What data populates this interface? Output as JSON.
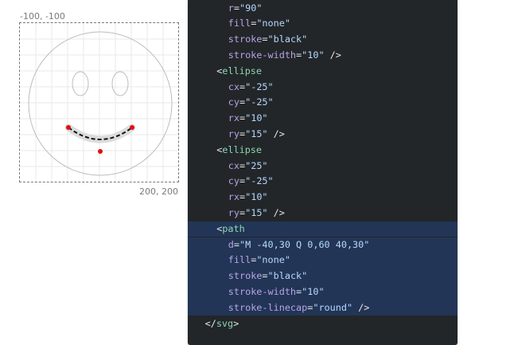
{
  "preview": {
    "coord_top_left": "-100, -100",
    "coord_bottom_right": "200, 200"
  },
  "code": {
    "lines": [
      {
        "indent": 3,
        "parts": [
          {
            "t": "attr",
            "v": "r"
          },
          {
            "t": "punc",
            "v": "="
          },
          {
            "t": "str",
            "v": "\"90\""
          }
        ]
      },
      {
        "indent": 3,
        "parts": [
          {
            "t": "attr",
            "v": "fill"
          },
          {
            "t": "punc",
            "v": "="
          },
          {
            "t": "str",
            "v": "\"none\""
          }
        ]
      },
      {
        "indent": 3,
        "parts": [
          {
            "t": "attr",
            "v": "stroke"
          },
          {
            "t": "punc",
            "v": "="
          },
          {
            "t": "str",
            "v": "\"black\""
          }
        ]
      },
      {
        "indent": 3,
        "parts": [
          {
            "t": "attr",
            "v": "stroke-width"
          },
          {
            "t": "punc",
            "v": "="
          },
          {
            "t": "str",
            "v": "\"10\""
          },
          {
            "t": "punc",
            "v": " />"
          }
        ]
      },
      {
        "indent": 2,
        "parts": [
          {
            "t": "punc",
            "v": "<"
          },
          {
            "t": "tag",
            "v": "ellipse"
          }
        ]
      },
      {
        "indent": 3,
        "parts": [
          {
            "t": "attr",
            "v": "cx"
          },
          {
            "t": "punc",
            "v": "="
          },
          {
            "t": "str",
            "v": "\"-25\""
          }
        ]
      },
      {
        "indent": 3,
        "parts": [
          {
            "t": "attr",
            "v": "cy"
          },
          {
            "t": "punc",
            "v": "="
          },
          {
            "t": "str",
            "v": "\"-25\""
          }
        ]
      },
      {
        "indent": 3,
        "parts": [
          {
            "t": "attr",
            "v": "rx"
          },
          {
            "t": "punc",
            "v": "="
          },
          {
            "t": "str",
            "v": "\"10\""
          }
        ]
      },
      {
        "indent": 3,
        "parts": [
          {
            "t": "attr",
            "v": "ry"
          },
          {
            "t": "punc",
            "v": "="
          },
          {
            "t": "str",
            "v": "\"15\""
          },
          {
            "t": "punc",
            "v": " />"
          }
        ]
      },
      {
        "indent": 2,
        "parts": [
          {
            "t": "punc",
            "v": "<"
          },
          {
            "t": "tag",
            "v": "ellipse"
          }
        ]
      },
      {
        "indent": 3,
        "parts": [
          {
            "t": "attr",
            "v": "cx"
          },
          {
            "t": "punc",
            "v": "="
          },
          {
            "t": "str",
            "v": "\"25\""
          }
        ]
      },
      {
        "indent": 3,
        "parts": [
          {
            "t": "attr",
            "v": "cy"
          },
          {
            "t": "punc",
            "v": "="
          },
          {
            "t": "str",
            "v": "\"-25\""
          }
        ]
      },
      {
        "indent": 3,
        "parts": [
          {
            "t": "attr",
            "v": "rx"
          },
          {
            "t": "punc",
            "v": "="
          },
          {
            "t": "str",
            "v": "\"10\""
          }
        ]
      },
      {
        "indent": 3,
        "parts": [
          {
            "t": "attr",
            "v": "ry"
          },
          {
            "t": "punc",
            "v": "="
          },
          {
            "t": "str",
            "v": "\"15\""
          },
          {
            "t": "punc",
            "v": " />"
          }
        ]
      },
      {
        "indent": 2,
        "highlight": true,
        "parts": [
          {
            "t": "punc",
            "v": "<"
          },
          {
            "t": "tag",
            "v": "path"
          }
        ]
      },
      {
        "indent": 3,
        "highlight": true,
        "parts": [
          {
            "t": "attr",
            "v": "d"
          },
          {
            "t": "punc",
            "v": "="
          },
          {
            "t": "str",
            "v": "\"M -40,30 Q 0,60 40,30\""
          }
        ]
      },
      {
        "indent": 3,
        "highlight": true,
        "parts": [
          {
            "t": "attr",
            "v": "fill"
          },
          {
            "t": "punc",
            "v": "="
          },
          {
            "t": "str",
            "v": "\"none\""
          }
        ]
      },
      {
        "indent": 3,
        "highlight": true,
        "parts": [
          {
            "t": "attr",
            "v": "stroke"
          },
          {
            "t": "punc",
            "v": "="
          },
          {
            "t": "str",
            "v": "\"black\""
          }
        ]
      },
      {
        "indent": 3,
        "highlight": true,
        "parts": [
          {
            "t": "attr",
            "v": "stroke-width"
          },
          {
            "t": "punc",
            "v": "="
          },
          {
            "t": "str",
            "v": "\"10\""
          }
        ]
      },
      {
        "indent": 3,
        "highlight": true,
        "parts": [
          {
            "t": "attr",
            "v": "stroke-linecap"
          },
          {
            "t": "punc",
            "v": "="
          },
          {
            "t": "str",
            "v": "\"round\""
          },
          {
            "t": "punc",
            "v": " />"
          }
        ]
      },
      {
        "indent": 1,
        "parts": [
          {
            "t": "punc",
            "v": "</"
          },
          {
            "t": "tag",
            "v": "svg"
          },
          {
            "t": "punc",
            "v": ">"
          }
        ]
      }
    ]
  }
}
